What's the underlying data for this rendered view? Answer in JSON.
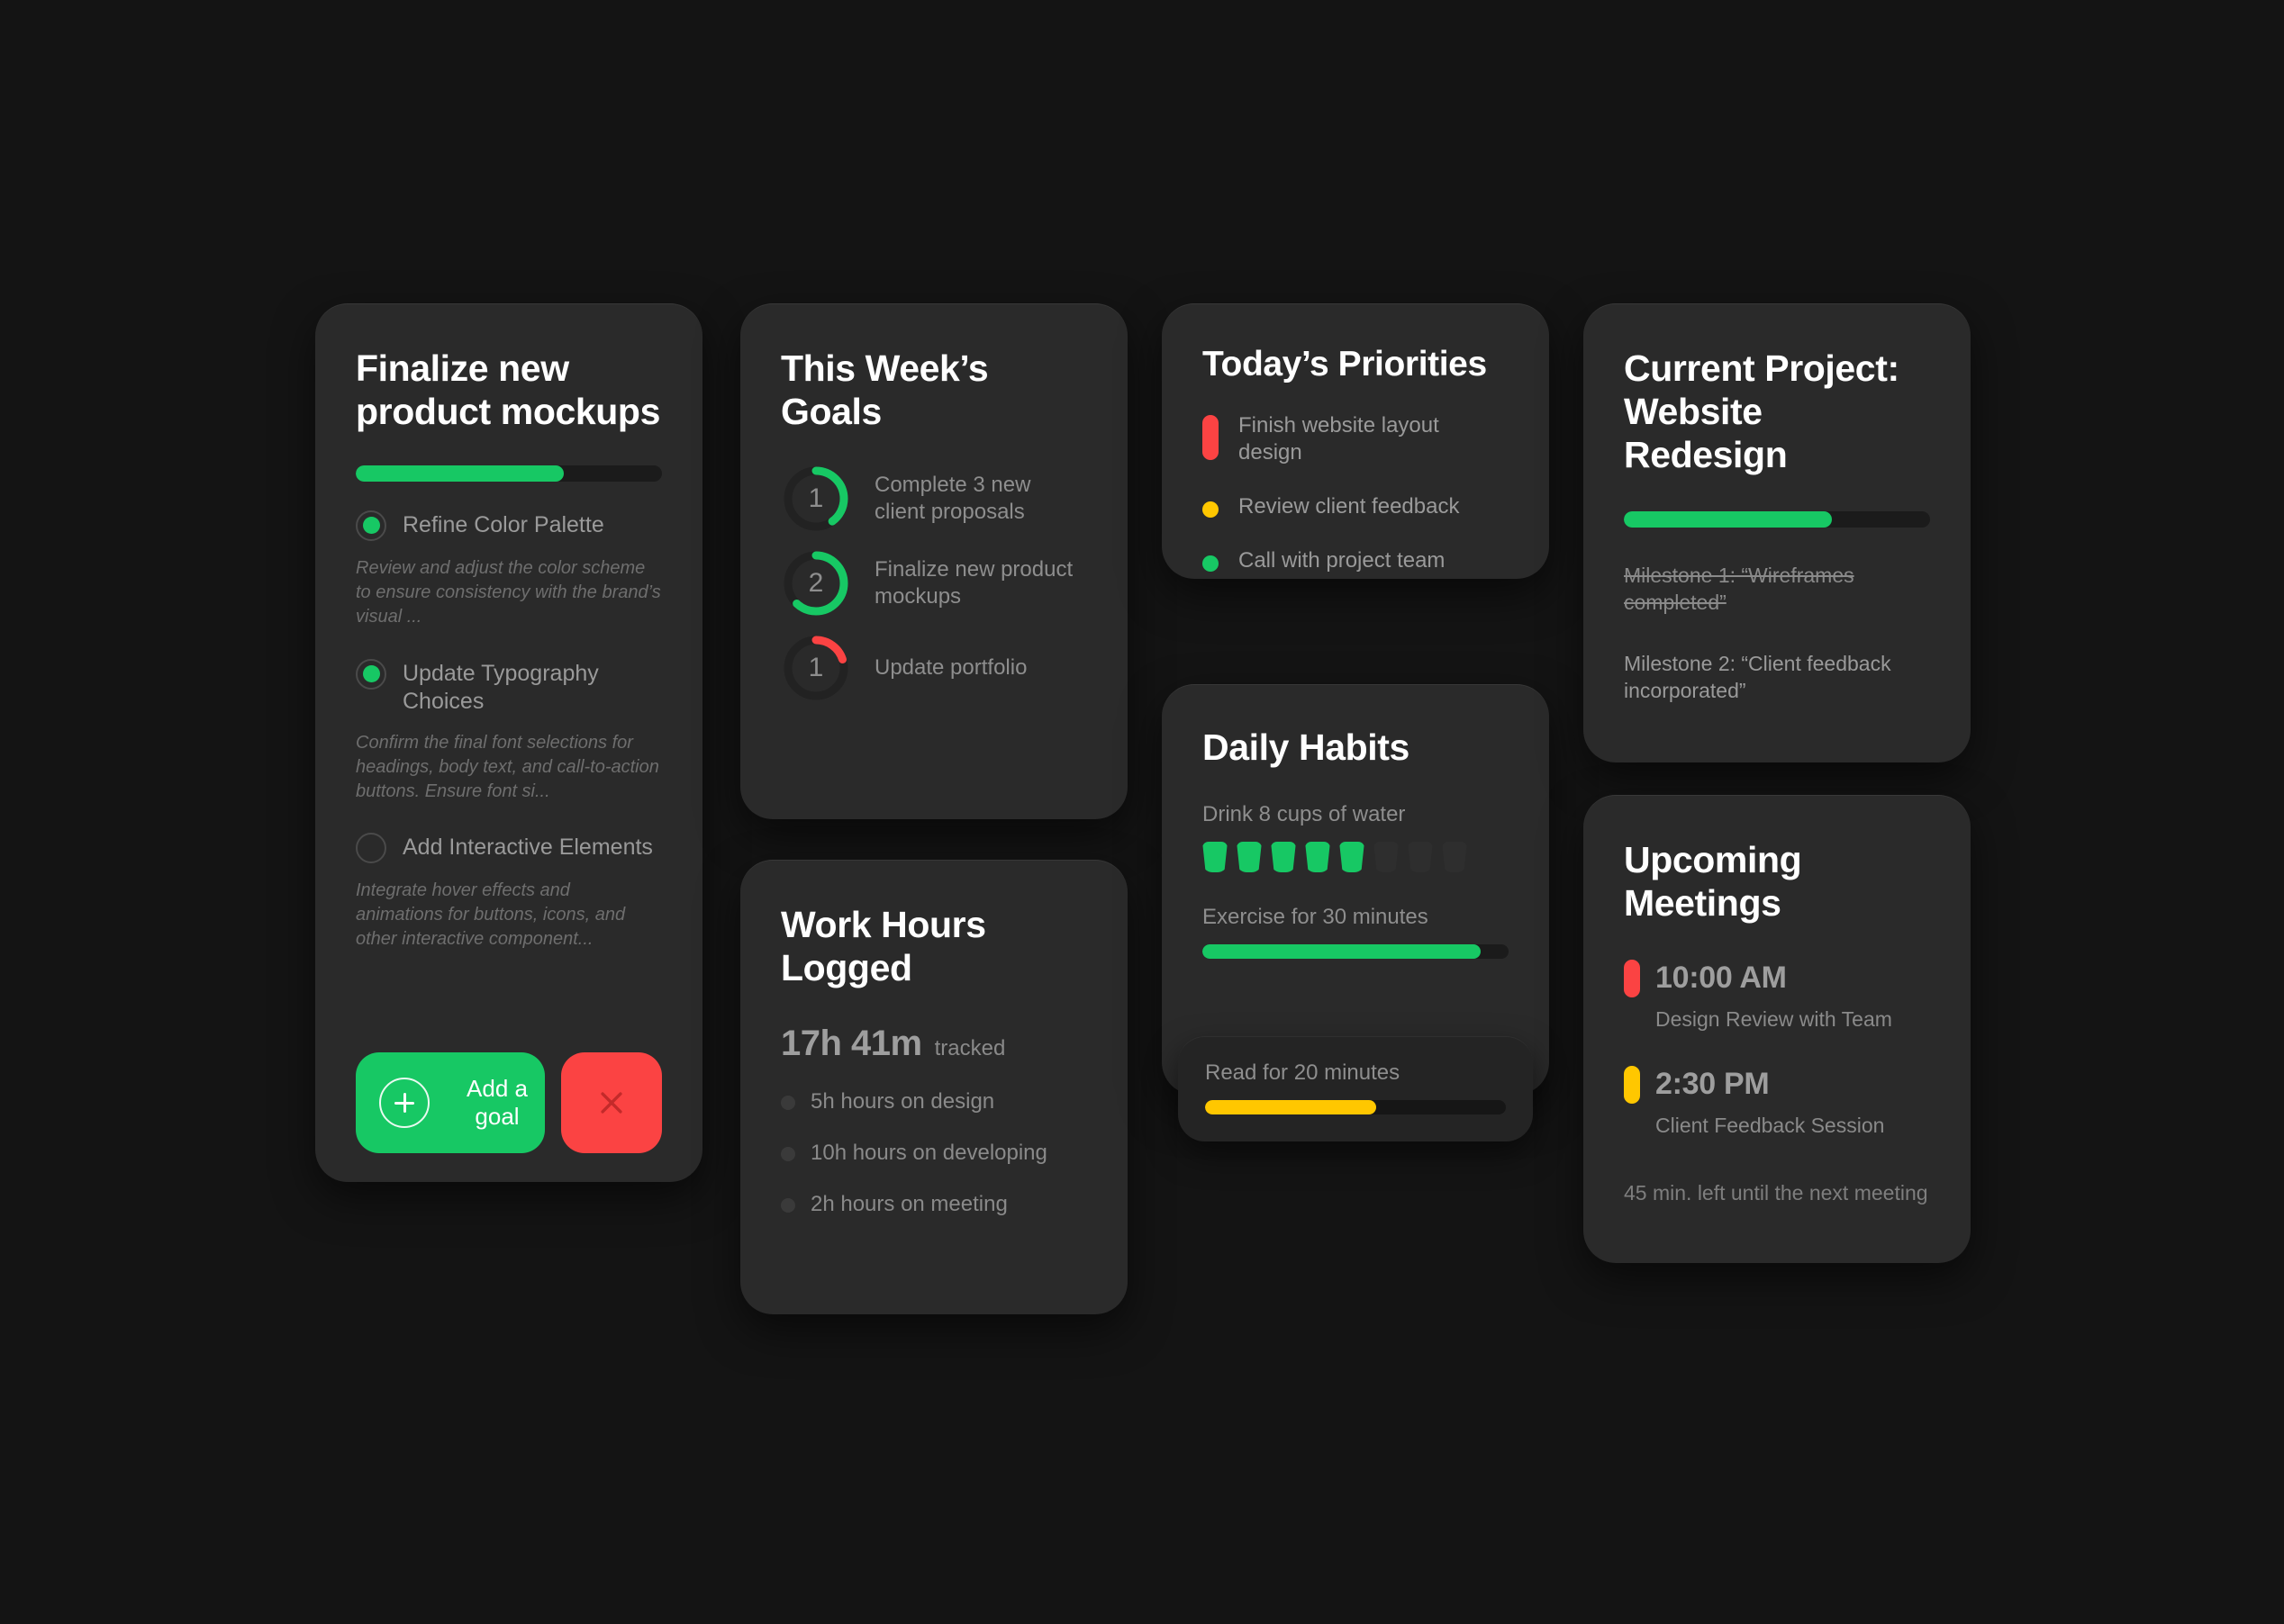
{
  "theme": {
    "background": "#141414",
    "card_bg": "#2a2a2a",
    "green": "#17c864",
    "red": "#fb4343",
    "yellow": "#ffc700",
    "track": "#1b1b1b"
  },
  "cards": {
    "mockups": {
      "title": "Finalize new product mockups",
      "progress_percent": 68,
      "tasks": [
        {
          "label": "Refine Color Palette",
          "checked": true,
          "description": "Review and adjust the color scheme to ensure consistency with the brand’s visual ..."
        },
        {
          "label": "Update Typography Choices",
          "checked": true,
          "description": "Confirm the final font selections for headings, body text, and call-to-action buttons. Ensure font si..."
        },
        {
          "label": "Add Interactive Elements",
          "checked": false,
          "description": "Integrate hover effects and animations for buttons, icons, and other interactive component..."
        }
      ],
      "add_button_label": "Add a goal",
      "add_button_icon": "plus-circle-icon",
      "dismiss_button_icon": "close-icon"
    },
    "goals": {
      "title": "This Week’s Goals",
      "items": [
        {
          "number": "1",
          "label": "Complete 3 new client proposals",
          "percent": 40,
          "color": "#17c864"
        },
        {
          "number": "2",
          "label": "Finalize new product mockups",
          "percent": 62,
          "color": "#17c864"
        },
        {
          "number": "1",
          "label": "Update portfolio",
          "percent": 20,
          "color": "#fb4343"
        }
      ]
    },
    "hours": {
      "title": "Work Hours Logged",
      "total": "17h 41m",
      "total_suffix": "tracked",
      "breakdown": [
        "5h hours on design",
        "10h hours on developing",
        "2h hours on meeting"
      ]
    },
    "priorities": {
      "title": "Today’s Priorities",
      "items": [
        {
          "text": "Finish website layout design",
          "color": "#fb4343",
          "shape": "tall"
        },
        {
          "text": "Review client feedback",
          "color": "#ffc700",
          "shape": "round"
        },
        {
          "text": "Call with project team",
          "color": "#17c864",
          "shape": "round"
        }
      ]
    },
    "habits": {
      "title": "Daily Habits",
      "water": {
        "label": "Drink 8 cups of water",
        "total": 8,
        "filled": 5
      },
      "exercise": {
        "label": "Exercise for 30 minutes",
        "percent": 91,
        "color": "#17c864"
      },
      "read": {
        "label": "Read for 20 minutes",
        "percent": 57,
        "color": "#ffc700"
      }
    },
    "project": {
      "title": "Current Project: Website Redesign",
      "progress_percent": 68,
      "milestones": [
        {
          "text": "Milestone 1: “Wireframes completed”",
          "done": true
        },
        {
          "text": "Milestone 2: “Client feedback incorporated”",
          "done": false
        }
      ]
    },
    "meetings": {
      "title": "Upcoming Meetings",
      "items": [
        {
          "time": "10:00 AM",
          "subject": "Design Review with Team",
          "color": "#fb4343"
        },
        {
          "time": "2:30 PM",
          "subject": "Client Feedback Session",
          "color": "#ffc700"
        }
      ],
      "footer": "45 min. left until the next meeting"
    }
  }
}
